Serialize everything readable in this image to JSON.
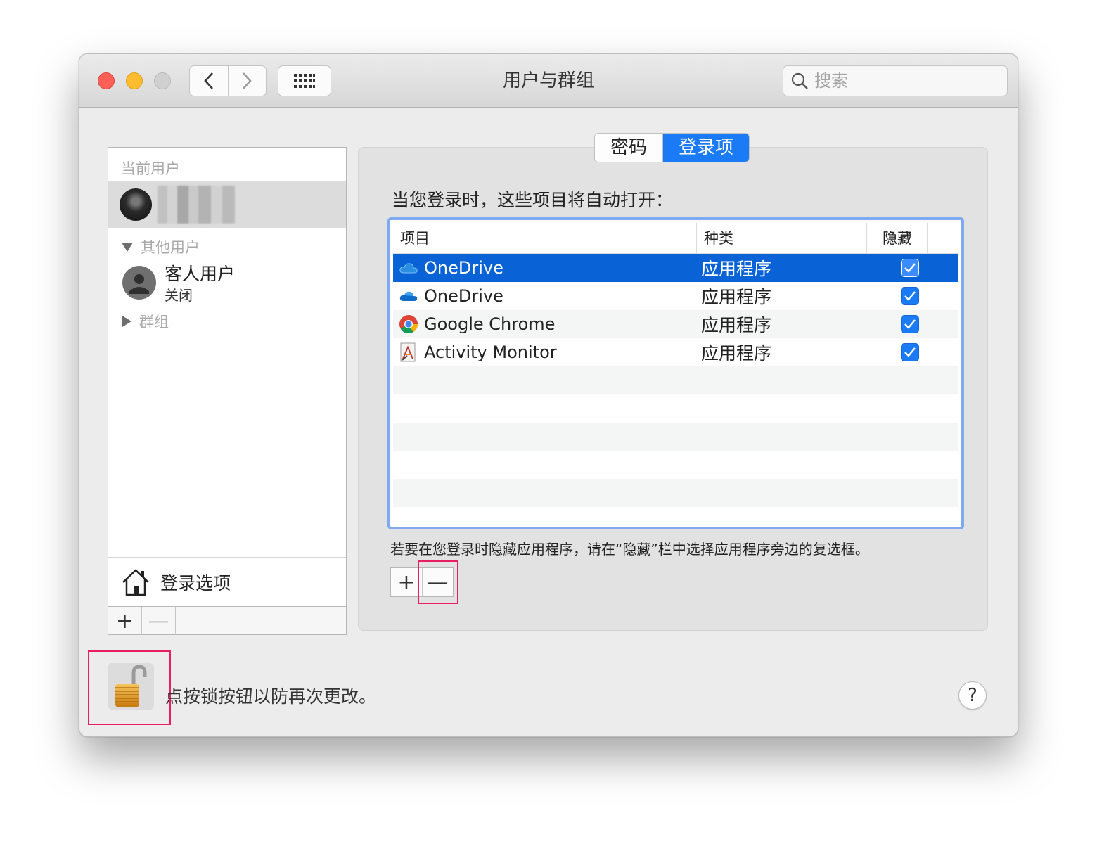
{
  "window": {
    "title": "用户与群组",
    "search_placeholder": "搜索"
  },
  "sidebar": {
    "current_user_header": "当前用户",
    "other_users_header": "其他用户",
    "guest_name": "客人用户",
    "guest_status": "关闭",
    "groups_label": "群组",
    "login_options_label": "登录选项",
    "add_label": "+",
    "remove_label": "—"
  },
  "tabs": [
    {
      "label": "密码",
      "active": false
    },
    {
      "label": "登录项",
      "active": true
    }
  ],
  "login_items": {
    "heading": "当您登录时，这些项目将自动打开：",
    "columns": [
      "项目",
      "种类",
      "隐藏"
    ],
    "rows": [
      {
        "name": "OneDrive",
        "kind": "应用程序",
        "hidden": true,
        "selected": true,
        "icon": "onedrive-icon"
      },
      {
        "name": "OneDrive",
        "kind": "应用程序",
        "hidden": true,
        "selected": false,
        "icon": "onedrive-icon"
      },
      {
        "name": "Google Chrome",
        "kind": "应用程序",
        "hidden": true,
        "selected": false,
        "icon": "chrome-icon"
      },
      {
        "name": "Activity Monitor",
        "kind": "应用程序",
        "hidden": true,
        "selected": false,
        "icon": "activity-monitor-icon"
      }
    ],
    "hint": "若要在您登录时隐藏应用程序，请在“隐藏”栏中选择应用程序旁边的复选框。",
    "add_label": "+",
    "remove_label": "—"
  },
  "footer": {
    "lock_text": "点按锁按钮以防再次更改。",
    "help_label": "?"
  },
  "colors": {
    "accent": "#1b7bf7",
    "selection": "#0a63d6",
    "highlight": "#e91e63"
  }
}
